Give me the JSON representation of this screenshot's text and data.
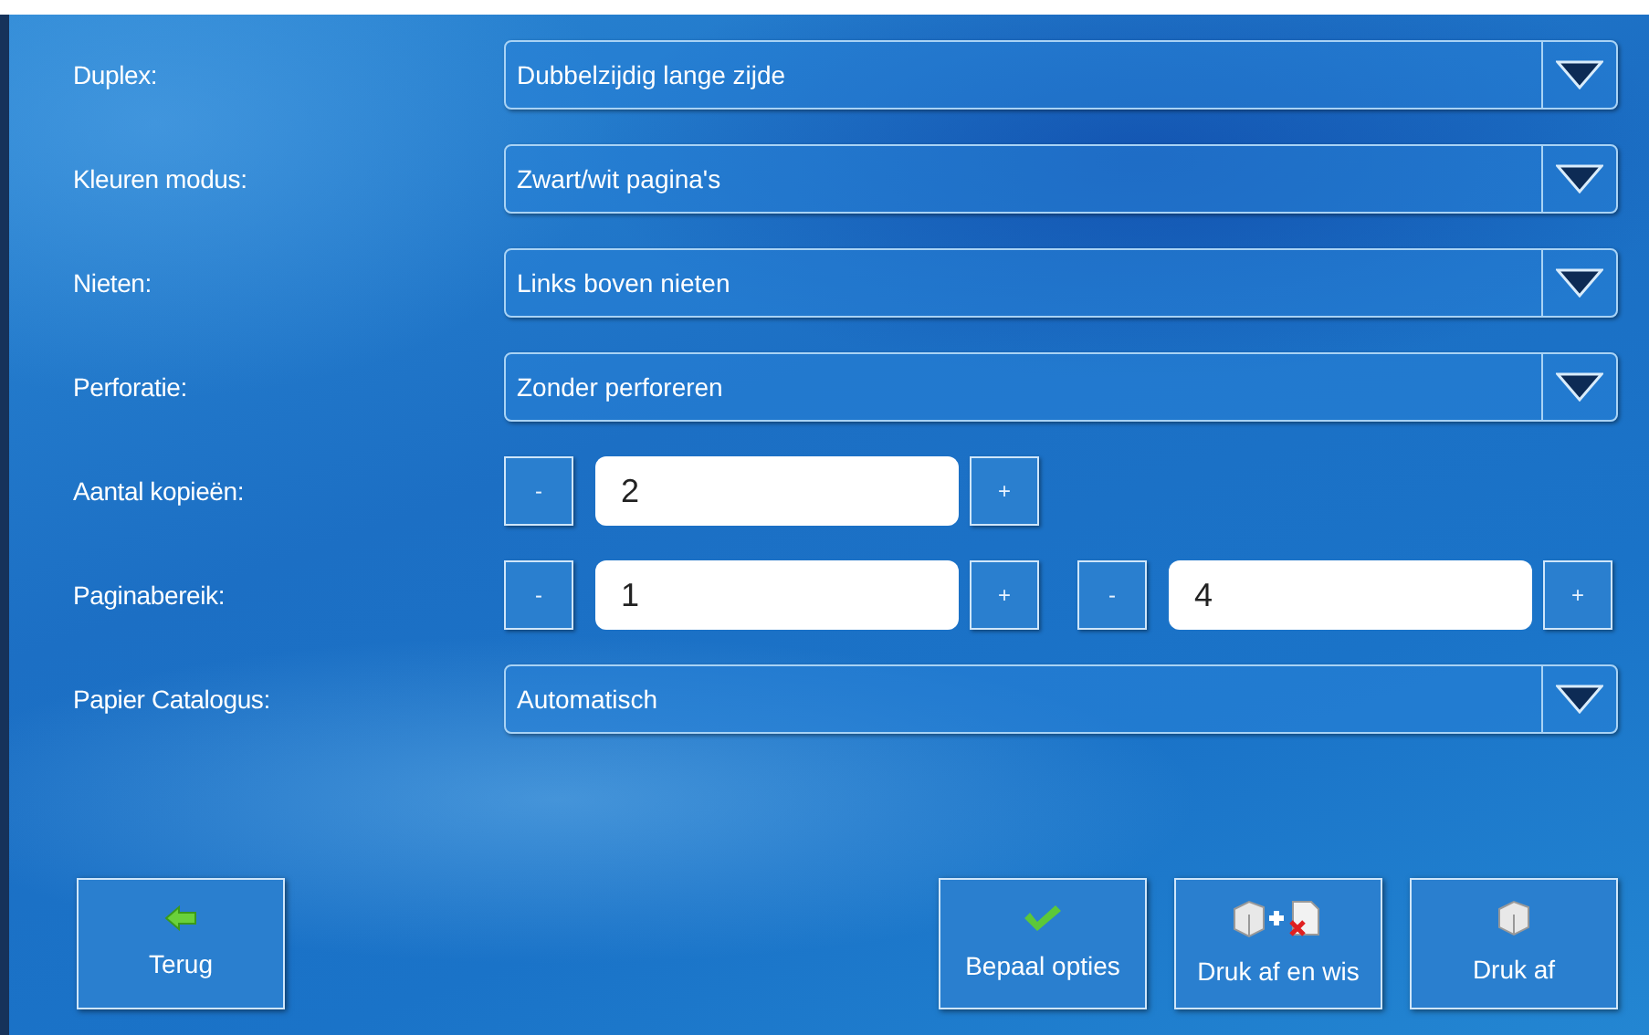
{
  "rows": [
    {
      "kind": "select",
      "label": "Duplex:",
      "value": "Dubbelzijdig lange zijde"
    },
    {
      "kind": "select",
      "label": "Kleuren modus:",
      "value": "Zwart/wit pagina's"
    },
    {
      "kind": "select",
      "label": "Nieten:",
      "value": "Links boven nieten"
    },
    {
      "kind": "select",
      "label": "Perforatie:",
      "value": "Zonder perforeren"
    },
    {
      "kind": "counter",
      "label": "Aantal kopieën:",
      "fields": [
        {
          "minus": "-",
          "value": "2",
          "plus": "+"
        }
      ]
    },
    {
      "kind": "counter",
      "label": "Paginabereik:",
      "fields": [
        {
          "minus": "-",
          "value": "1",
          "plus": "+"
        },
        {
          "minus": "-",
          "value": "4",
          "plus": "+"
        }
      ]
    },
    {
      "kind": "select",
      "label": "Papier Catalogus:",
      "value": "Automatisch"
    }
  ],
  "buttons": [
    {
      "kind": "back",
      "label": "Terug"
    },
    {
      "kind": "confirm",
      "label": "Bepaal opties"
    },
    {
      "kind": "print-delete",
      "label": "Druk af en wis"
    },
    {
      "kind": "print",
      "label": "Druk af"
    }
  ]
}
